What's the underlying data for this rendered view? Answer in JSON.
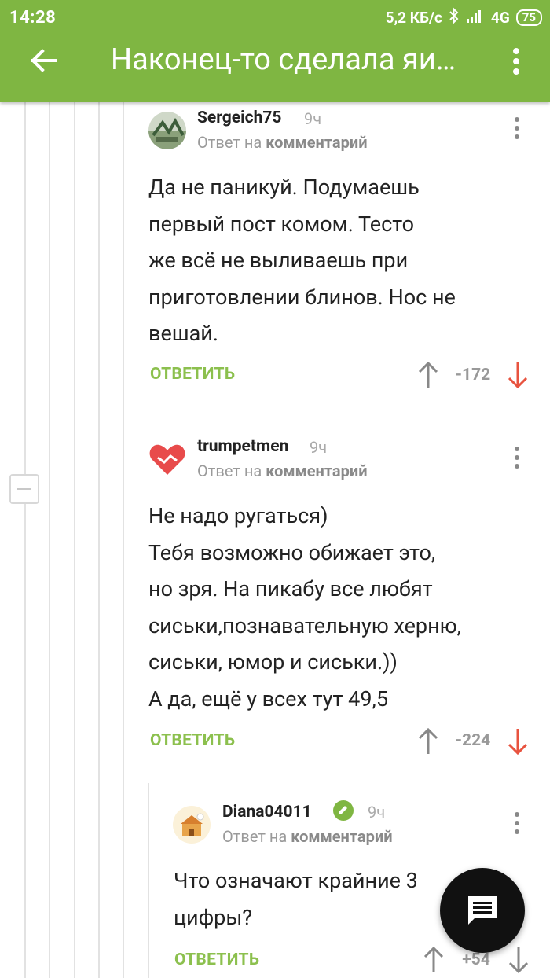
{
  "status_bar": {
    "time": "14:28",
    "network_speed": "5,2 КБ/с",
    "network_type": "4G",
    "battery": "75"
  },
  "app_bar": {
    "title": "Наконец-то сделала яи…"
  },
  "colors": {
    "accent": "#7fb642",
    "reply_green": "#8cc04e",
    "downvote_red": "#e8533f"
  },
  "comments": [
    {
      "author": "Sergeich75",
      "age": "9ч",
      "reply_prefix": "Ответ на",
      "reply_target": "комментарий",
      "text": "Да не паникуй. Подумаешь\nпервый пост комом. Тесто\nже всё не выливаешь при\nприготовлении блинов. Нос не\nвешай.",
      "reply_label": "ОТВЕТИТЬ",
      "rating": "-172"
    },
    {
      "author": "trumpetmen",
      "age": "9ч",
      "reply_prefix": "Ответ на",
      "reply_target": "комментарий",
      "text": "Не надо ругаться)\nТебя возможно обижает это,\nно зря. На пикабу все любят\nсиськи,познавательную херню,\nсиськи, юмор и сиськи.))\nА да, ещё у всех тут 49,5",
      "reply_label": "ОТВЕТИТЬ",
      "rating": "-224"
    },
    {
      "author": "Diana04011",
      "age": "9ч",
      "reply_prefix": "Ответ на",
      "reply_target": "комментарий",
      "text": "Что означают крайние 3\nцифры?",
      "reply_label": "ОТВЕТИТЬ",
      "rating": "+54"
    }
  ]
}
